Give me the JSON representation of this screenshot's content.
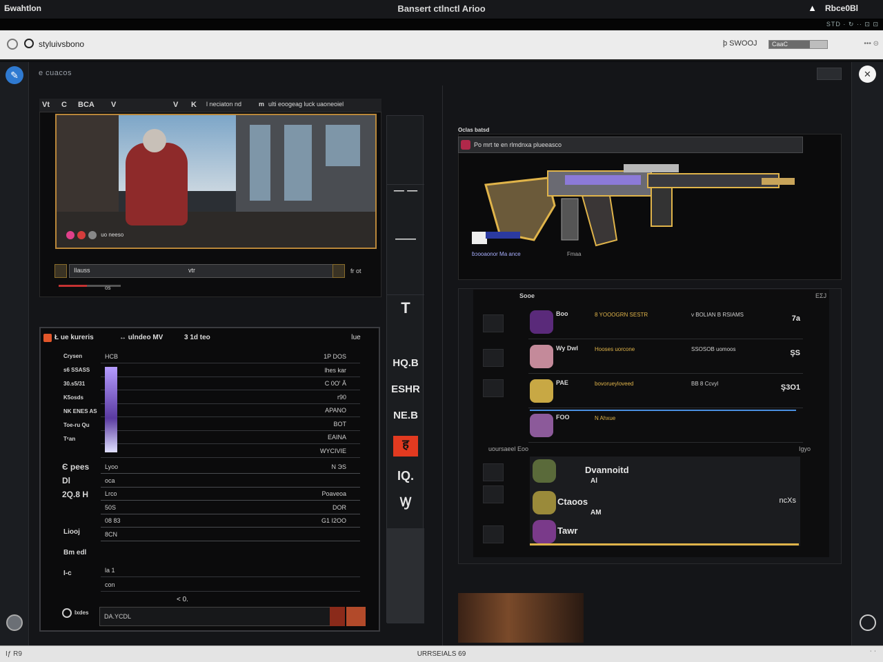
{
  "window": {
    "app_name": "Бwahtlon",
    "title": "Bansert ctlnctl Arioo",
    "user": "Rbce0Bl",
    "top_chips": "STD · ↻ ·· ⊡ ⊡"
  },
  "addressbar": {
    "url": "styluivsbono",
    "search_label": "ϸ SWOOJ",
    "meter_label": "CaaC",
    "meter_fraction": 0.7,
    "tail": "••• ⊝"
  },
  "main": {
    "header": "e cuacos"
  },
  "video_panel": {
    "toolbar": [
      "Vt",
      "C",
      "BCA",
      "V",
      "V",
      "K",
      "l neciaton nd",
      "m",
      "ulti eoogeag luck uaoneoiel"
    ],
    "hud_text": "uo neeso",
    "control_label": "Ilauss",
    "control_mid": "vtr",
    "control_right": "fr ot",
    "progress_fraction": 0.45,
    "progress_value": "os"
  },
  "strip": {
    "labels": [
      "— —",
      "——",
      "T",
      "HQ.B",
      "ESHR",
      "NE.B",
      "ह",
      "IQ.",
      "Ꝡ"
    ]
  },
  "table_panel": {
    "bar": [
      "Ł ue kureris",
      "↔ ulndeo MV",
      "3 1d teo",
      "ǀue"
    ],
    "row_labels": [
      "Crysen",
      "s6 SSASS",
      "30.s5/31",
      "K5osds",
      "NK ENES AS",
      "Toe-ru Qu",
      "Tᶜan"
    ],
    "rows": [
      {
        "a": "HCB",
        "b": "1P DOS"
      },
      {
        "a": "",
        "b": "lhes kar"
      },
      {
        "a": "",
        "b": "C 0O' Ă"
      },
      {
        "a": "",
        "b": "r90"
      },
      {
        "a": "",
        "b": "APANO"
      },
      {
        "a": "",
        "b": "BOT"
      },
      {
        "a": "",
        "b": "EAINA"
      },
      {
        "a": "",
        "b": "WYCIVIE"
      }
    ],
    "group2_labels": [
      "Є pees",
      "Dl",
      "2Q.8 H"
    ],
    "rows2": [
      {
        "a": "Lyoo",
        "b": "N ЭS"
      },
      {
        "a": "oca",
        "b": ""
      },
      {
        "a": "Lrco",
        "b": "Poaveoa"
      },
      {
        "a": "50S",
        "b": "DOR"
      },
      {
        "a": "08 83",
        "b": "G1 I2OO"
      },
      {
        "a": "8CN",
        "b": ""
      }
    ],
    "group3_labels": [
      "Liooj",
      "Bm edl",
      "I-c"
    ],
    "rows3": [
      {
        "a": "la 1",
        "b": ""
      },
      {
        "a": "con",
        "b": ""
      }
    ],
    "footer_left": "Ixdes",
    "footer_input": "DA.YCDL",
    "footer_marker": "< 0."
  },
  "gun_panel": {
    "header": "Oclas batsd",
    "bar_text": "Po mrt te en rlmdnxa plueeasco",
    "caption": "ɓɔooaonor Ma  ance",
    "tag": "Fmaa"
  },
  "list_panel": {
    "header": "Sooe",
    "header_right": "EΣJ",
    "items": [
      {
        "t1": "Boo",
        "t2": "8 YOOOGRN SESTR",
        "t3": "ν BOLIAN B RSIAMS",
        "t4": "7a"
      },
      {
        "t1": "Wy Dwl",
        "t2": "Hooses uorcone",
        "t3": "SSOSOB uomoos",
        "t4": "ŞS"
      },
      {
        "t1": "PAE",
        "t2": "bovorueyloveed",
        "t3": "BB 8 Ccvyl",
        "t4": "Ş3O1"
      },
      {
        "t1": "FOO",
        "t2": "N Ahxue",
        "t3": "",
        "t4": ""
      }
    ],
    "section2_header": "uoursaeel Eoo",
    "section2_right": "Igyo",
    "friends": [
      {
        "name": "Dvannoitd",
        "sub": "Al",
        "right": ""
      },
      {
        "name": "Ctaoos",
        "sub": "AM",
        "right": "ncXs"
      },
      {
        "name": "Tawr",
        "sub": "",
        "right": ""
      }
    ]
  },
  "statusbar": {
    "left": "Iƒ R9",
    "center": "URRSEIALS 69",
    "right": "ˈ ˈ"
  },
  "colors": {
    "accent_gold": "#e0b44a",
    "accent_red": "#c53232",
    "accent_blue": "#2f7ad1",
    "background": "#141518"
  }
}
